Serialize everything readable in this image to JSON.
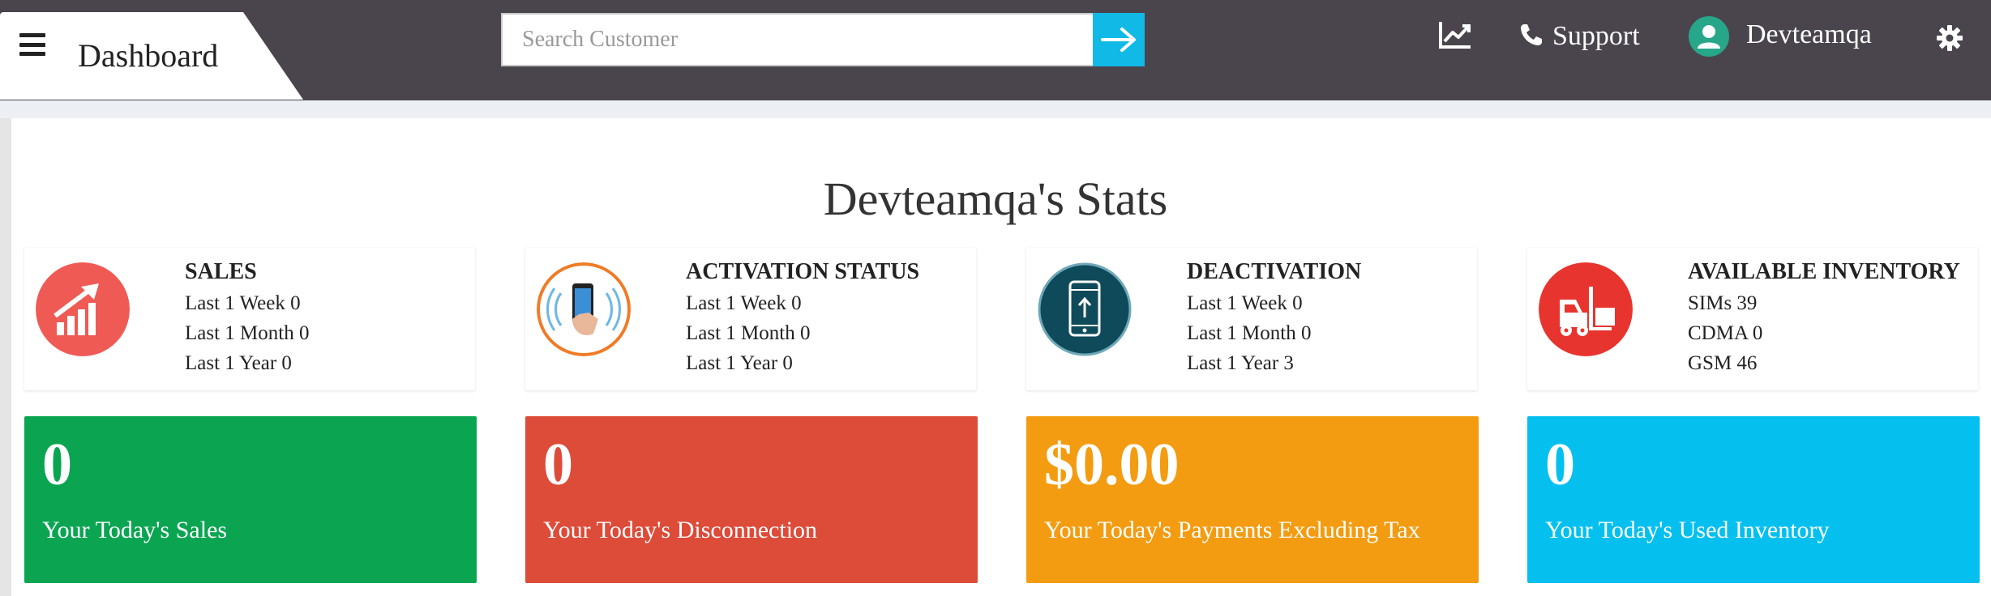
{
  "header": {
    "title": "Dashboard",
    "search_placeholder": "Search Customer",
    "support_label": "Support",
    "user_name": "Devteamqa"
  },
  "stats_title": "Devteamqa's Stats",
  "cards": [
    {
      "title": "SALES",
      "lines": [
        "Last 1 Week 0",
        "Last 1 Month 0",
        "Last 1 Year 0"
      ],
      "icon": "sales-chart-icon",
      "color": "#f05a55"
    },
    {
      "title": "ACTIVATION STATUS",
      "lines": [
        "Last 1 Week 0",
        "Last 1 Month 0",
        "Last 1 Year 0"
      ],
      "icon": "phone-activation-icon",
      "color": "#f07b26"
    },
    {
      "title": "DEACTIVATION",
      "lines": [
        "Last 1 Week 0",
        "Last 1 Month 0",
        "Last 1 Year 3"
      ],
      "icon": "phone-deactivation-icon",
      "color": "#0f4a5a"
    },
    {
      "title": "AVAILABLE INVENTORY",
      "lines": [
        "SIMs 39",
        "CDMA 0",
        "GSM 46"
      ],
      "icon": "forklift-icon",
      "color": "#e8342e"
    }
  ],
  "tiles": [
    {
      "value": "0",
      "label": "Your Today's Sales",
      "color": "#0ba552"
    },
    {
      "value": "0",
      "label": "Your Today's Disconnection",
      "color": "#dd4b39"
    },
    {
      "value": "$0.00",
      "label": "Your Today's Payments Excluding Tax",
      "color": "#f39c12"
    },
    {
      "value": "0",
      "label": "Your Today's Used Inventory",
      "color": "#05c0ef"
    }
  ]
}
